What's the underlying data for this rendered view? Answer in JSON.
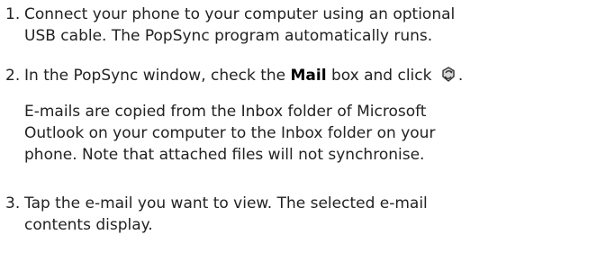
{
  "steps": [
    {
      "number": "1.",
      "lines": [
        "Connect your phone to your computer using an optional",
        "USB cable. The PopSync program automatically runs."
      ]
    },
    {
      "number": "2.",
      "prefix": "In the PopSync window, check the ",
      "bold": "Mail",
      "suffix": " box and click ",
      "end": ".",
      "icon": "sync-icon",
      "note_lines": [
        "E-mails are copied from the Inbox folder of Microsoft",
        "Outlook on your computer to the Inbox folder on your",
        "phone. Note that attached files will not synchronise."
      ]
    },
    {
      "number": "3.",
      "lines": [
        "Tap the e-mail you want to view. The selected e-mail",
        "contents display."
      ]
    }
  ]
}
